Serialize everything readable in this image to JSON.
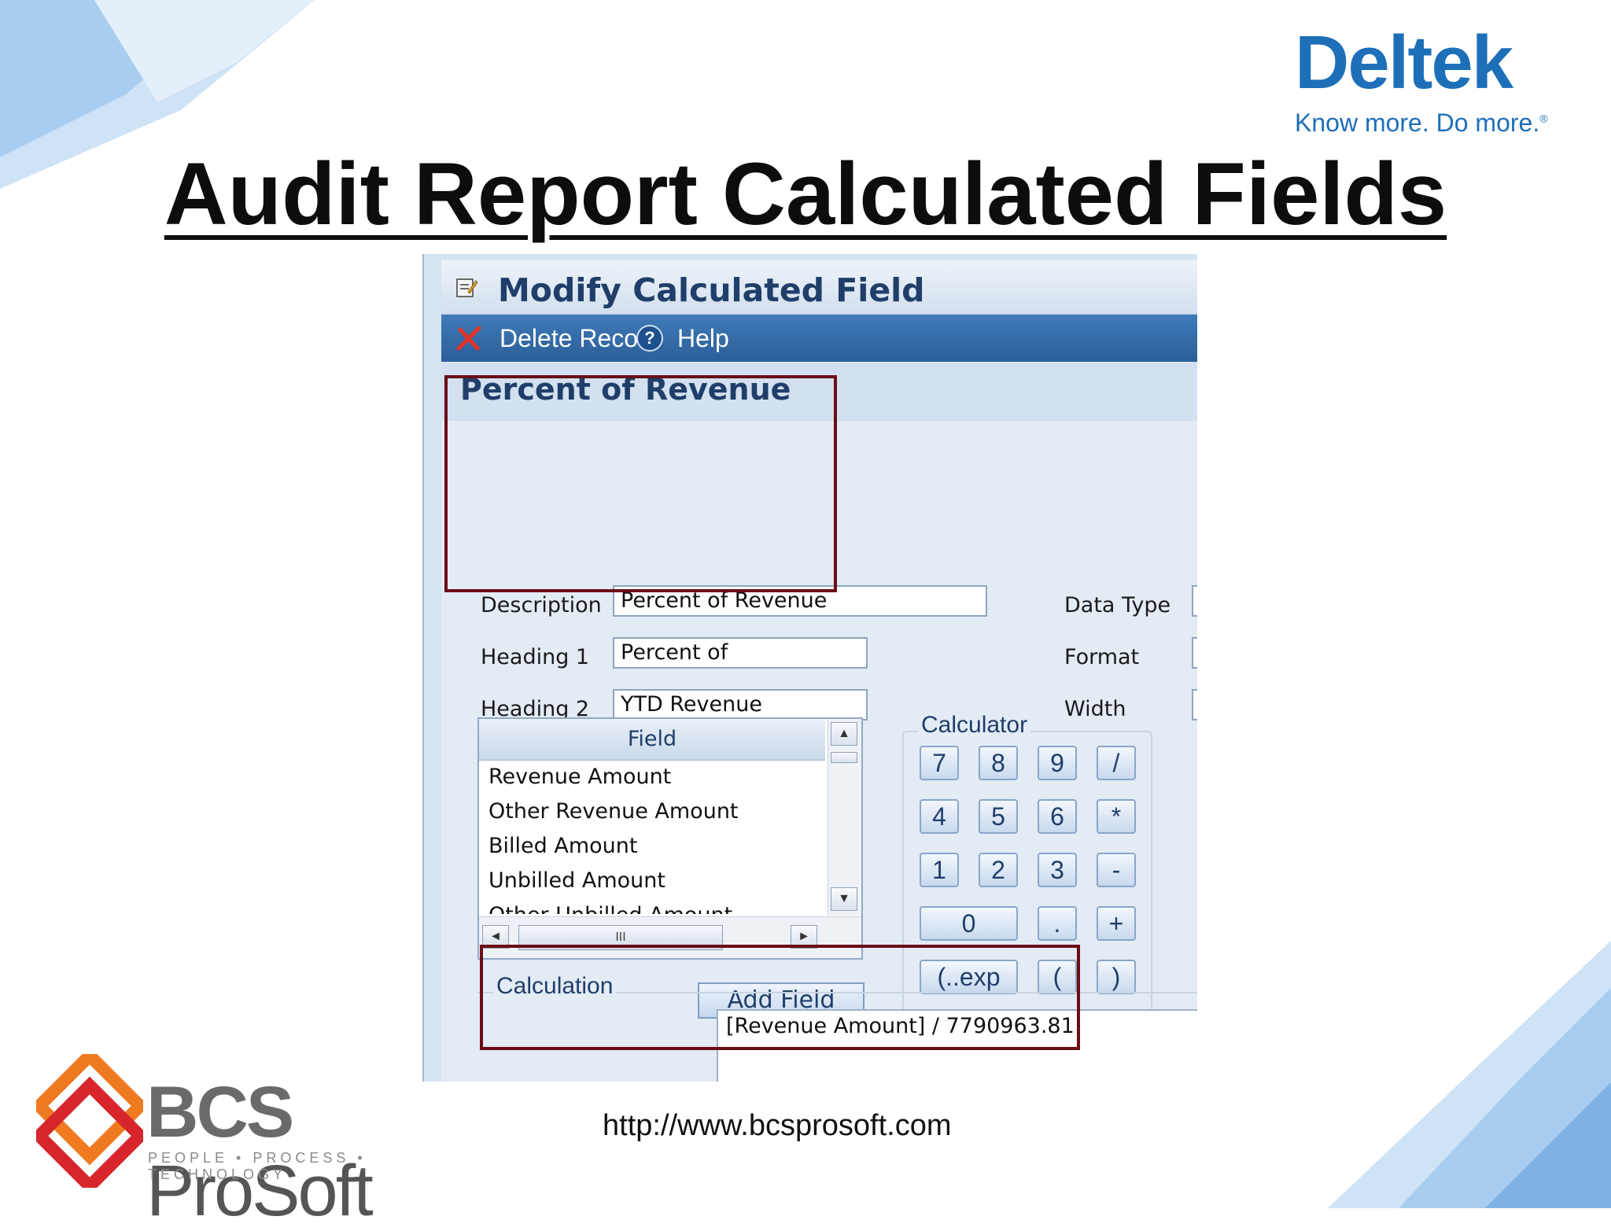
{
  "slide": {
    "title": "Audit Report Calculated Fields",
    "url": "http://www.bcsprosoft.com"
  },
  "deltek": {
    "name": "Deltek",
    "tagline": "Know more. Do more.",
    "reg": "®",
    "brand_color": "#1d6fb8"
  },
  "bcs": {
    "name_bold": "BCS",
    "name_rest": " ProSoft",
    "tagline": "PEOPLE • PROCESS • TECHNOLOGY"
  },
  "window": {
    "title": "Modify Calculated Field",
    "toolbar": {
      "delete_label": "Delete Record",
      "help_label": "Help"
    },
    "record_title": "Percent of Revenue"
  },
  "form": {
    "description_label": "Description",
    "description_value": "Percent of Revenue",
    "heading1_label": "Heading 1",
    "heading1_value": "Percent of",
    "heading2_label": "Heading 2",
    "heading2_value": "YTD Revenue",
    "data_type_label": "Data Type",
    "format_label": "Format",
    "width_label": "Width"
  },
  "field_list": {
    "header": "Field",
    "rows": [
      "Revenue Amount",
      "Other Revenue Amount",
      "Billed Amount",
      "Unbilled Amount",
      "Other Unbilled Amount"
    ],
    "scroll_up": "▲",
    "scroll_down": "▼",
    "scroll_left": "◄",
    "scroll_right": "►",
    "thumb_grip": "III"
  },
  "add_field_label": "Add Field",
  "calculator": {
    "legend": "Calculator",
    "keys": [
      "7",
      "8",
      "9",
      "/",
      "4",
      "5",
      "6",
      "*",
      "1",
      "2",
      "3",
      "-",
      "0",
      ".",
      "+",
      "(..exp",
      "(",
      ")"
    ]
  },
  "calculation": {
    "label": "Calculation",
    "value": "[Revenue Amount] / 7790963.81"
  },
  "colors": {
    "highlight_box": "#6b0d16",
    "toolbar": "#2c5f98",
    "title_text": "#1f3e6a"
  }
}
